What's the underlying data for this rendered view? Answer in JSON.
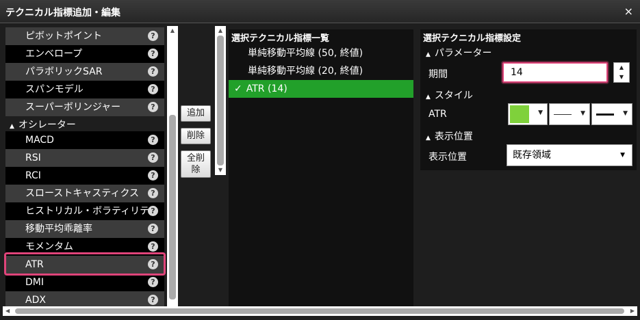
{
  "window": {
    "title": "テクニカル指標追加・編集",
    "close": "×"
  },
  "indicator_list": {
    "items": [
      "ピボットポイント",
      "エンベロープ",
      "パラボリックSAR",
      "スパンモデル",
      "スーパーボリンジャー",
      "MACD",
      "RSI",
      "RCI",
      "スローストキャスティクス",
      "ヒストリカル・ボラティリティ",
      "移動平均乖離率",
      "モメンタム",
      "ATR",
      "DMI",
      "ADX"
    ],
    "category_oscillator": "オシレーター",
    "help": "?"
  },
  "buttons": {
    "add": "追加",
    "delete": "削除",
    "delete_all": "全削除"
  },
  "selected_list": {
    "title": "選択テクニカル指標一覧",
    "rows": [
      "単純移動平均線 (50, 終値)",
      "単純移動平均線 (20, 終値)",
      "ATR (14)"
    ],
    "check": "✓"
  },
  "settings": {
    "title": "選択テクニカル指標設定",
    "section_parameters": "パラメーター",
    "period_label": "期間",
    "period_value": "14",
    "section_style": "スタイル",
    "style_label": "ATR",
    "line_color": "#7fd13b",
    "section_display": "表示位置",
    "display_label": "表示位置",
    "display_value": "既存領域"
  },
  "colors": {
    "highlight": "#e0447a",
    "selected_row": "#22a02a"
  },
  "icons": {
    "collapse": "▲",
    "dropdown": "▼",
    "spin_up": "▲",
    "spin_down": "▼"
  }
}
